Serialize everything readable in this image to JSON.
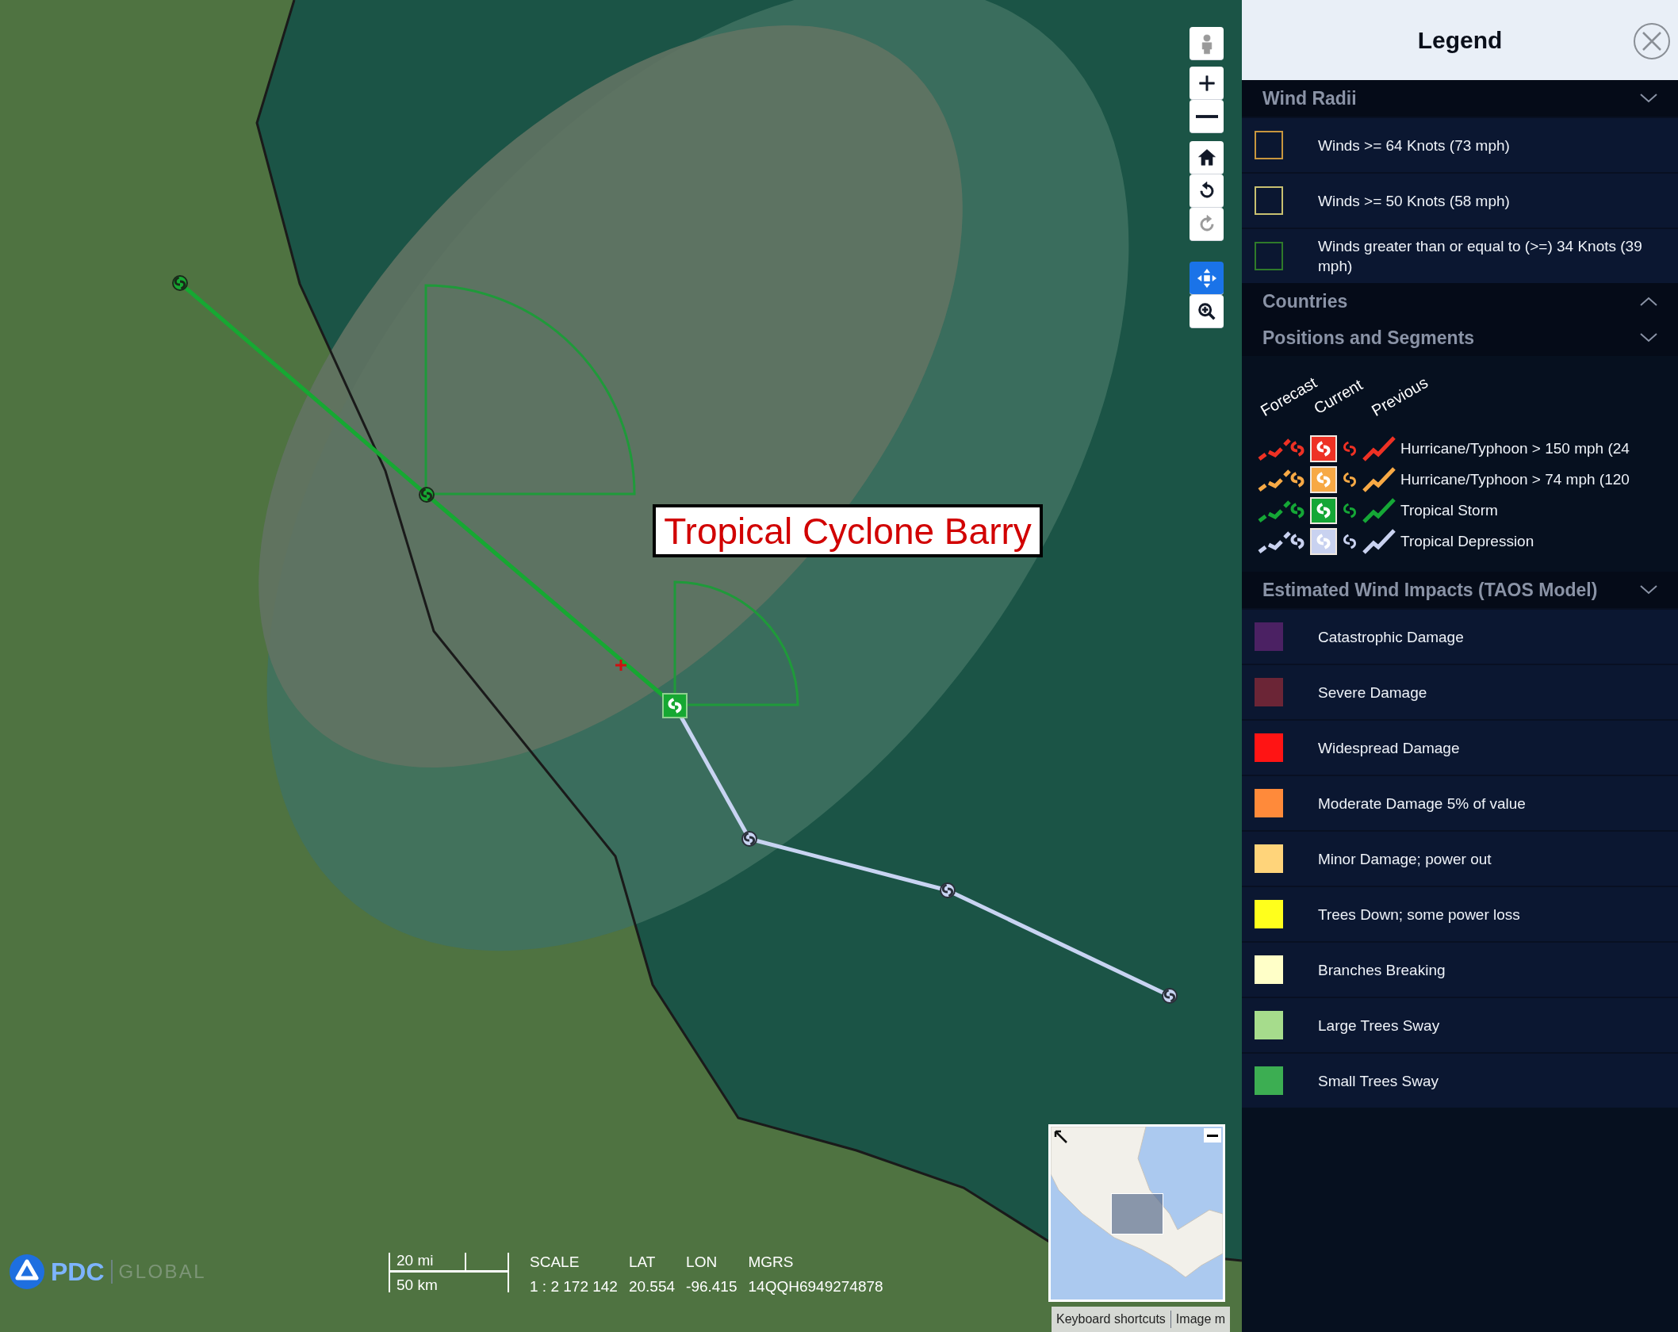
{
  "map": {
    "storm_label": "Tropical Cyclone Barry",
    "track": [
      {
        "kind": "previous",
        "color": "#16a832"
      },
      {
        "kind": "previous",
        "color": "#16a832"
      },
      {
        "kind": "current",
        "color": "#16a832"
      },
      {
        "kind": "forecast",
        "color": "#c8d4f2"
      },
      {
        "kind": "forecast",
        "color": "#c8d4f2"
      },
      {
        "kind": "forecast",
        "color": "#c8d4f2"
      }
    ],
    "controls": [
      {
        "kind": "person",
        "disabled": true,
        "selected": false
      },
      {
        "kind": "zoom-in",
        "disabled": false,
        "selected": false
      },
      {
        "kind": "zoom-out",
        "disabled": false,
        "selected": false
      },
      {
        "kind": "home",
        "disabled": false,
        "selected": false
      },
      {
        "kind": "rotate-left",
        "disabled": false,
        "selected": false
      },
      {
        "kind": "rotate-right",
        "disabled": true,
        "selected": false
      },
      {
        "kind": "pan",
        "disabled": false,
        "selected": true
      },
      {
        "kind": "zoom-box",
        "disabled": false,
        "selected": false
      }
    ],
    "logo": {
      "name": "PDC",
      "tagline": "GLOBAL"
    },
    "scale_bar": {
      "miles": "20 mi",
      "km": "50 km"
    },
    "readout": [
      {
        "label": "SCALE",
        "value": "1 : 2 172 142"
      },
      {
        "label": "LAT",
        "value": "20.554"
      },
      {
        "label": "LON",
        "value": "-96.415"
      },
      {
        "label": "MGRS",
        "value": "14QQH6949274878"
      }
    ],
    "attribution": [
      "Keyboard shortcuts",
      "Image m"
    ]
  },
  "legend": {
    "title": "Legend",
    "sections": [
      {
        "kind": "radii",
        "title": "Wind Radii",
        "expanded": true,
        "items": [
          {
            "color": "#c8963e",
            "label": "Winds >= 64 Knots (73 mph)"
          },
          {
            "color": "#c8c070",
            "label": "Winds >= 50 Knots (58 mph)"
          },
          {
            "color": "#2f7a2a",
            "label": "Winds greater than or equal to (>=) 34 Knots (39 mph)"
          }
        ]
      },
      {
        "kind": "countries",
        "title": "Countries",
        "expanded": false
      },
      {
        "kind": "positions",
        "title": "Positions and Segments",
        "expanded": true,
        "columns": [
          "Forecast",
          "Current",
          "Previous"
        ],
        "items": [
          {
            "color": "#ee3124",
            "label": "Hurricane/Typhoon > 150 mph (24"
          },
          {
            "color": "#f7a945",
            "label": "Hurricane/Typhoon > 74 mph (120"
          },
          {
            "color": "#15a736",
            "label": "Tropical Storm"
          },
          {
            "color": "#c9d2f0",
            "label": "Tropical Depression"
          }
        ]
      },
      {
        "kind": "impacts",
        "title": "Estimated Wind Impacts (TAOS Model)",
        "expanded": true,
        "items": [
          {
            "color": "#4b2163",
            "label": "Catastrophic Damage"
          },
          {
            "color": "#6b2536",
            "label": "Severe Damage"
          },
          {
            "color": "#ff1414",
            "label": "Widespread Damage"
          },
          {
            "color": "#ff8a3a",
            "label": "Moderate Damage 5% of value"
          },
          {
            "color": "#ffd47a",
            "label": "Minor Damage; power out"
          },
          {
            "color": "#ffff1c",
            "label": "Trees Down; some power loss"
          },
          {
            "color": "#ffffc8",
            "label": "Branches Breaking"
          },
          {
            "color": "#a6dc8c",
            "label": "Large Trees Sway"
          },
          {
            "color": "#3cae52",
            "label": "Small Trees Sway"
          }
        ]
      }
    ]
  }
}
